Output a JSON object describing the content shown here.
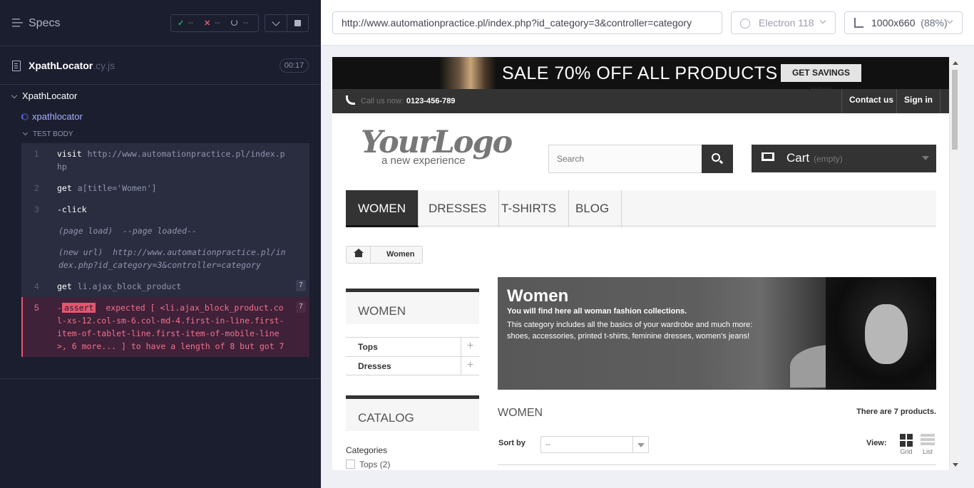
{
  "runner": {
    "specs_title": "Specs",
    "stats": {
      "passed": "--",
      "failed": "--",
      "pending": "--"
    },
    "file": {
      "name": "XpathLocator",
      "ext": ".cy.js",
      "duration": "00:17"
    },
    "suite_title": "XpathLocator",
    "test_title": "xpathlocator",
    "body_label": "TEST BODY",
    "commands": [
      {
        "num": "1",
        "name": "visit",
        "message": "http://www.automationpractice.pl/index.php"
      },
      {
        "num": "2",
        "name": "get",
        "message": "a[title='Women']"
      },
      {
        "num": "3",
        "name": "-click",
        "message": ""
      },
      {
        "sub": true,
        "label": "(page load)",
        "message": "--page loaded--"
      },
      {
        "sub": true,
        "label": "(new url)",
        "message": "http://www.automationpractice.pl/index.php?id_category=3&controller=category"
      },
      {
        "num": "4",
        "name": "get",
        "message": "li.ajax_block_product",
        "badge": "7"
      },
      {
        "num": "5",
        "name": "-",
        "keyword": "assert",
        "message": "expected [ <li.ajax_block_product.col-xs-12.col-sm-6.col-md-4.first-in-line.first-item-of-tablet-line.first-item-of-mobile-line>, 6 more... ] to have a length of 8 but got 7",
        "badge": "7",
        "error": true
      }
    ]
  },
  "aut": {
    "url": "http://www.automationpractice.pl/index.php?id_category=3&controller=category",
    "browser": "Electron 118",
    "viewport": "1000x660",
    "zoom": "(88%)"
  },
  "site": {
    "banner": {
      "sale": "SALE 70% OFF ALL PRODUCTS",
      "cta": "GET SAVINGS NOW"
    },
    "topnav": {
      "call_label": "Call us now:",
      "phone": "0123-456-789",
      "contact": "Contact us",
      "signin": "Sign in"
    },
    "logo": {
      "text": "YourLogo",
      "tagline": "a new experience"
    },
    "search": {
      "placeholder": "Search"
    },
    "cart": {
      "label": "Cart",
      "status": "(empty)"
    },
    "menu": [
      "WOMEN",
      "DRESSES",
      "T-SHIRTS",
      "BLOG"
    ],
    "breadcrumb": "Women",
    "sidebar": {
      "women_title": "WOMEN",
      "categories": [
        "Tops",
        "Dresses"
      ],
      "catalog_title": "CATALOG",
      "categories_label": "Categories",
      "filter_first": "Tops (2)"
    },
    "hero": {
      "title": "Women",
      "line1": "You will find here all woman fashion collections.",
      "line2": "This category includes all the basics of your wardrobe and much more:",
      "line3": "shoes, accessories, printed t-shirts, feminine dresses, women's jeans!"
    },
    "listing": {
      "heading": "WOMEN",
      "count": "There are 7 products.",
      "sort_label": "Sort by",
      "sort_value": "--",
      "view_label": "View:",
      "grid": "Grid",
      "list": "List"
    }
  }
}
